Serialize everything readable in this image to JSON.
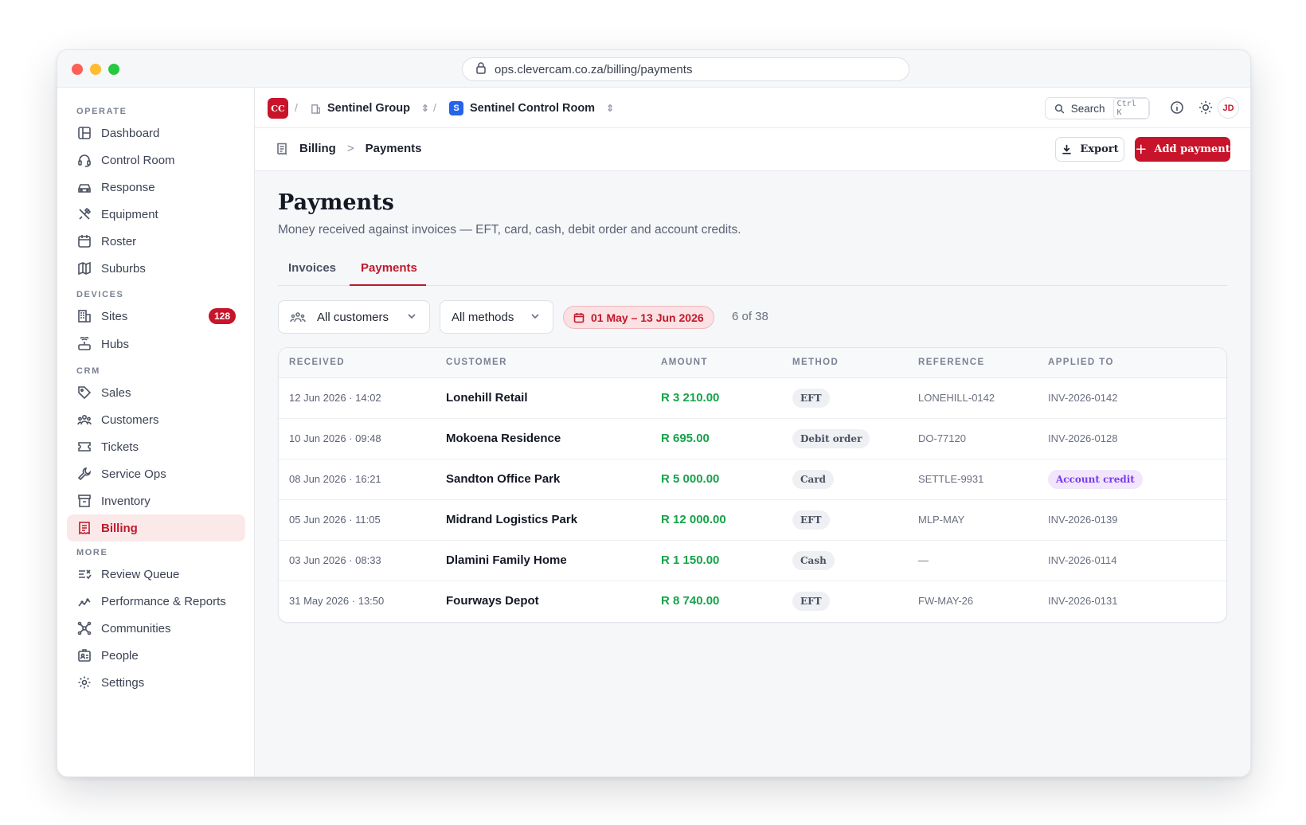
{
  "browser": {
    "url": "ops.clevercam.co.za/billing/payments"
  },
  "sidebar": {
    "sections": [
      {
        "label": "OPERATE"
      },
      {
        "label": "DEVICES"
      },
      {
        "label": "CRM"
      },
      {
        "label": "MORE"
      }
    ],
    "items": [
      {
        "label": "Dashboard",
        "icon": "layout-icon"
      },
      {
        "label": "Control Room",
        "icon": "headset-icon"
      },
      {
        "label": "Response",
        "icon": "car-icon"
      },
      {
        "label": "Equipment",
        "icon": "tools-icon"
      },
      {
        "label": "Roster",
        "icon": "calendar-icon"
      },
      {
        "label": "Suburbs",
        "icon": "map-icon"
      },
      {
        "label": "Sites",
        "icon": "building-icon",
        "badge": "128"
      },
      {
        "label": "Hubs",
        "icon": "router-icon"
      },
      {
        "label": "Sales",
        "icon": "tag-icon"
      },
      {
        "label": "Customers",
        "icon": "users-icon"
      },
      {
        "label": "Tickets",
        "icon": "ticket-icon"
      },
      {
        "label": "Service Ops",
        "icon": "wrench-icon"
      },
      {
        "label": "Inventory",
        "icon": "archive-icon"
      },
      {
        "label": "Billing",
        "icon": "receipt-icon",
        "active": true
      },
      {
        "label": "Review Queue",
        "icon": "list-check-icon"
      },
      {
        "label": "Performance & Reports",
        "icon": "trend-icon"
      },
      {
        "label": "Communities",
        "icon": "network-icon"
      },
      {
        "label": "People",
        "icon": "badge-icon"
      },
      {
        "label": "Settings",
        "icon": "gear-icon"
      }
    ]
  },
  "topbar": {
    "org_logo": "CC",
    "sep": "/",
    "group": "Sentinel Group",
    "room_badge": "S",
    "room": "Sentinel Control Room",
    "search_label": "Search",
    "search_shortcut": "Ctrl K",
    "avatar": "JD"
  },
  "pagebar": {
    "crumb_parent": "Billing",
    "crumb_sep": ">",
    "crumb_current": "Payments",
    "export_label": "Export",
    "add_label": "Add payment"
  },
  "page": {
    "title": "Payments",
    "subtitle": "Money received against invoices — EFT, card, cash, debit order and account credits.",
    "tabs": [
      "Invoices",
      "Payments"
    ],
    "active_tab": "Payments"
  },
  "filters": {
    "customer": "All customers",
    "method": "All methods",
    "date_range": "01 May – 13 Jun 2026",
    "count": "6 of 38"
  },
  "table": {
    "headers": [
      "RECEIVED",
      "CUSTOMER",
      "AMOUNT",
      "METHOD",
      "REFERENCE",
      "APPLIED TO"
    ],
    "rows": [
      {
        "received": "12 Jun 2026 · 14:02",
        "customer": "Lonehill Retail",
        "amount": "R 3 210.00",
        "method": "EFT",
        "reference": "LONEHILL-0142",
        "applied": "INV-2026-0142"
      },
      {
        "received": "10 Jun 2026 · 09:48",
        "customer": "Mokoena Residence",
        "amount": "R 695.00",
        "method": "Debit order",
        "reference": "DO-77120",
        "applied": "INV-2026-0128"
      },
      {
        "received": "08 Jun 2026 · 16:21",
        "customer": "Sandton Office Park",
        "amount": "R 5 000.00",
        "method": "Card",
        "reference": "SETTLE-9931",
        "applied": "Account credit"
      },
      {
        "received": "05 Jun 2026 · 11:05",
        "customer": "Midrand Logistics Park",
        "amount": "R 12 000.00",
        "method": "EFT",
        "reference": "MLP-MAY",
        "applied": "INV-2026-0139"
      },
      {
        "received": "03 Jun 2026 · 08:33",
        "customer": "Dlamini Family Home",
        "amount": "R 1 150.00",
        "method": "Cash",
        "reference": "—",
        "applied": "INV-2026-0114"
      },
      {
        "received": "31 May 2026 · 13:50",
        "customer": "Fourways Depot",
        "amount": "R 8 740.00",
        "method": "EFT",
        "reference": "FW-MAY-26",
        "applied": "INV-2026-0131"
      }
    ]
  },
  "colors": {
    "brand": "#c8142b",
    "positive": "#16a34a",
    "credit": "#7c3aed"
  }
}
